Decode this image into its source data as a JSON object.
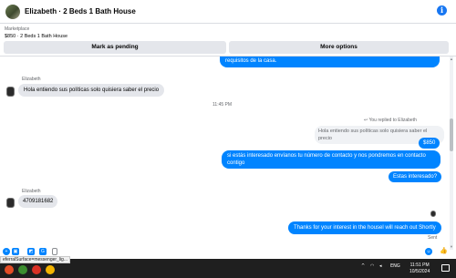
{
  "header": {
    "title": "Elizabeth · 2 Beds 1 Bath House",
    "info_icon": "info-icon",
    "info_glyph": "i"
  },
  "marketplace": {
    "label": "Marketplace",
    "listing": "$850 · 2 Beds 1 Bath House"
  },
  "actions": {
    "pending_label": "Mark as pending",
    "more_label": "More options"
  },
  "messages": {
    "top_partial": "requisitos de la casa.",
    "sender_1": "Elizabeth",
    "incoming_1": "Hola entiendo sus políticas solo quisiera saber el precio",
    "time_1": "11:45 PM",
    "replied_label": "You replied to Elizabeth",
    "reply_quote": "Hola entiendo sus políticas solo quisiera saber el precio",
    "out_price": "$850",
    "out_contact": "si estás interesado envíanos tu número de contacto y nos pondremos en contacto contigo",
    "out_interested": "Estas interesado?",
    "sender_2": "Elizabeth",
    "incoming_2": "4709181682",
    "out_thanks": "Thanks for your interest in the housel will reach out Shortly",
    "sent_label": "Sent"
  },
  "status_bar": {
    "url": "eferralSurface=messenger_lig..."
  },
  "taskbar": {
    "lang": "ENG",
    "time": "11:51 PM",
    "date": "10/5/2024",
    "caret": "^"
  },
  "colors": {
    "accent": "#0084ff",
    "info": "#1877f2",
    "bubble_in": "#e4e6eb"
  }
}
